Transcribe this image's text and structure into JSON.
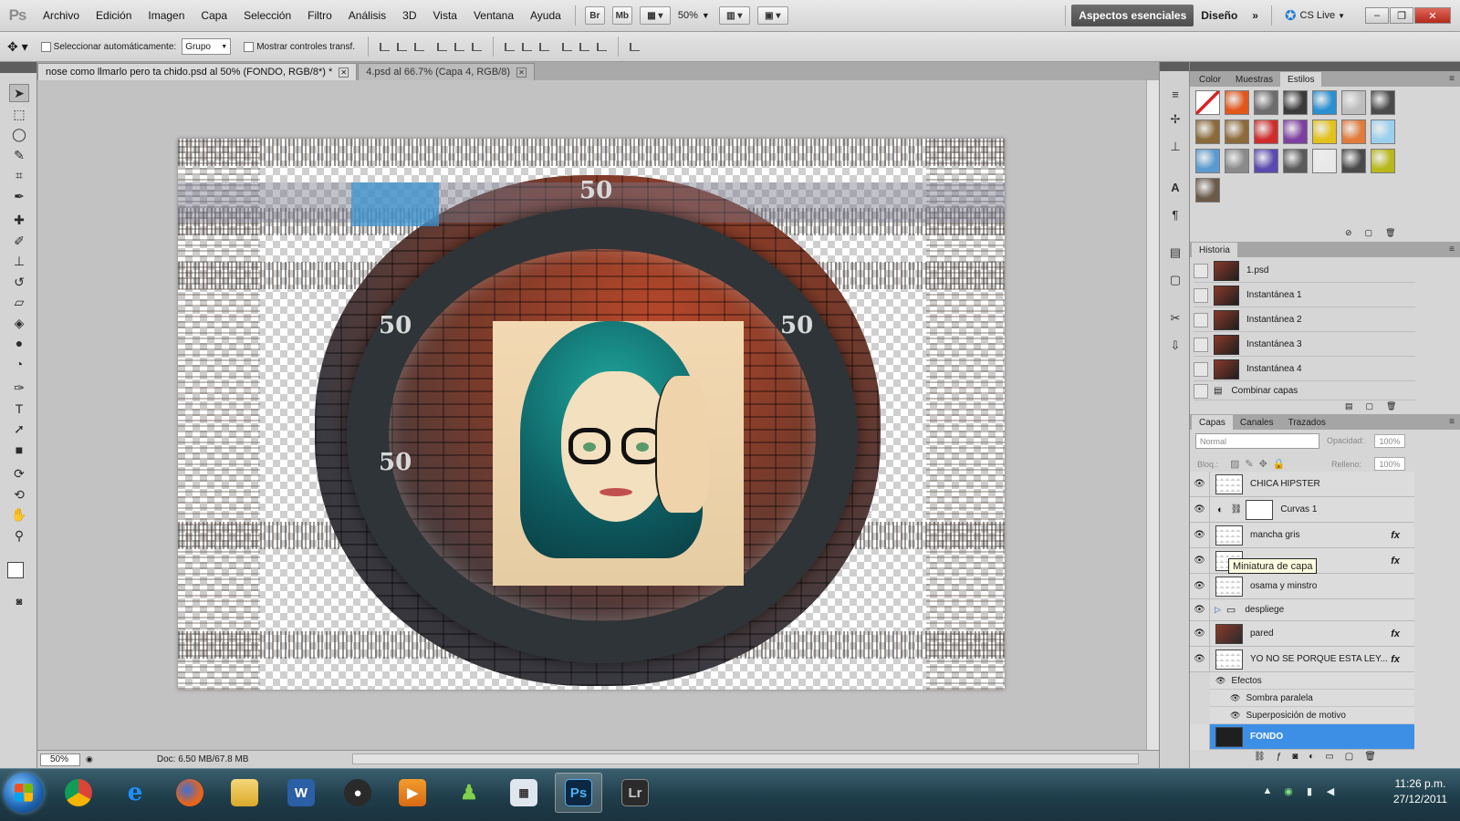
{
  "menubar": {
    "logo": "Ps",
    "items": [
      "Archivo",
      "Edición",
      "Imagen",
      "Capa",
      "Selección",
      "Filtro",
      "Análisis",
      "3D",
      "Vista",
      "Ventana",
      "Ayuda"
    ],
    "bridge_btn": "Br",
    "minibridge_btn": "Mb",
    "zoom": "50%",
    "workspace_active": "Aspectos esenciales",
    "workspace_other": "Diseño",
    "more": "»",
    "cslive": "CS Live"
  },
  "options": {
    "auto_select_label": "Seleccionar automáticamente:",
    "auto_select_value": "Grupo",
    "show_transform_label": "Mostrar controles transf."
  },
  "tabs": [
    {
      "label": "nose como llmarlo pero ta chido.psd al 50% (FONDO, RGB/8*) *"
    },
    {
      "label": "4.psd al 66.7% (Capa 4, RGB/8)"
    }
  ],
  "canvas": {
    "ring_number": "50"
  },
  "status": {
    "zoom": "50%",
    "doc": "Doc: 6.50 MB/67.8 MB"
  },
  "panels": {
    "top_tabs": [
      "Color",
      "Muestras",
      "Estilos"
    ],
    "styles_colors": [
      "#c0392b",
      "#e2561a",
      "#6d6d6d",
      "#3a3a3a",
      "#2a8fd0",
      "#bdbdbd",
      "#4a4a4a",
      "#8a6a3a",
      "#8d6a3a",
      "#d02c2c",
      "#7f3fa0",
      "#e2c21a",
      "#e27a3a",
      "#9ad0ee",
      "#5a9ad0",
      "#8a8a8a",
      "#5a4ab0",
      "#5a5a5a",
      "#e8e8e8",
      "#4a4a4a",
      "#b8b81a",
      "#6a5a4a"
    ],
    "history_tab": "Historia",
    "history": [
      "1.psd",
      "Instantánea 1",
      "Instantánea 2",
      "Instantánea 3",
      "Instantánea 4",
      "Combinar capas"
    ],
    "layers_tabs": [
      "Capas",
      "Canales",
      "Trazados"
    ],
    "blend_mode": "Normal",
    "opacity_label": "Opacidad:",
    "opacity": "100%",
    "lock_label": "Bloq.:",
    "fill_label": "Relleno:",
    "fill": "100%",
    "layers": [
      {
        "name": "CHICA HIPSTER",
        "fx": ""
      },
      {
        "name": "Curvas 1",
        "fx": ""
      },
      {
        "name": "mancha gris",
        "fx": "fx"
      },
      {
        "name": "",
        "fx": "fx"
      },
      {
        "name": "osama y minstro",
        "fx": ""
      },
      {
        "name": "despliege",
        "fx": ""
      },
      {
        "name": "pared",
        "fx": "fx"
      },
      {
        "name": "YO NO SE PORQUE ESTA LEY...",
        "fx": "fx"
      }
    ],
    "effects_label": "Efectos",
    "effects": [
      "Sombra paralela",
      "Superposición de motivo"
    ],
    "selected_layer": "FONDO",
    "tooltip": "Miniatura de capa"
  },
  "taskbar": {
    "time": "11:26 p.m.",
    "date": "27/12/2011",
    "ps_label": "Ps",
    "lr_label": "Lr"
  }
}
